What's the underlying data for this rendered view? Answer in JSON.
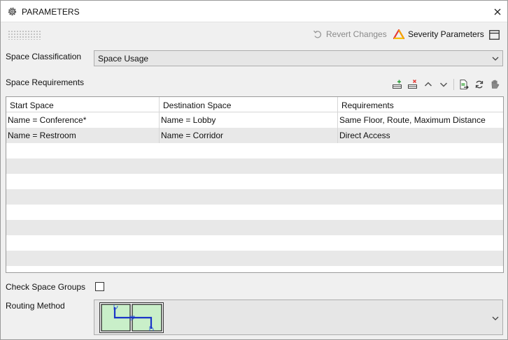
{
  "window": {
    "title": "PARAMETERS"
  },
  "toolbar": {
    "revert_label": "Revert Changes",
    "severity_label": "Severity Parameters"
  },
  "space_classification": {
    "label": "Space Classification",
    "value": "Space Usage"
  },
  "space_requirements": {
    "label": "Space Requirements",
    "columns": [
      "Start Space",
      "Destination Space",
      "Requirements"
    ],
    "rows": [
      {
        "start": "Name = Conference*",
        "destination": "Name = Lobby",
        "requirements": "Same Floor, Route, Maximum Distance"
      },
      {
        "start": "Name = Restroom",
        "destination": "Name = Corridor",
        "requirements": "Direct Access"
      }
    ]
  },
  "check_space_groups": {
    "label": "Check Space Groups",
    "checked": false
  },
  "routing_method": {
    "label": "Routing Method"
  },
  "colors": {
    "accent": "#2a5bd7",
    "room_fill": "#c9efc9",
    "warning_red": "#e53935",
    "warning_orange": "#f5a300"
  }
}
